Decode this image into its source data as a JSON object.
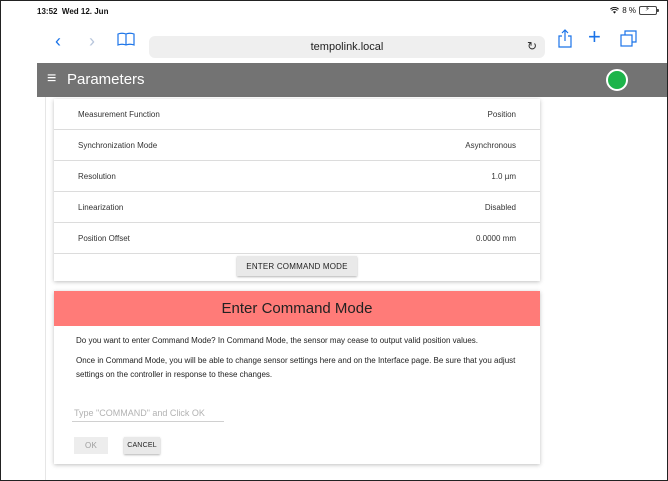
{
  "status_bar": {
    "time": "13:52",
    "date": "Wed 12. Jun",
    "battery": "8 %"
  },
  "browser": {
    "url": "tempolink.local",
    "icons": {
      "back": "chevron-left-icon",
      "forward": "chevron-right-icon",
      "bookmarks": "book-icon",
      "reload": "reload-icon",
      "share": "share-icon",
      "new_tab": "plus-icon",
      "tabs": "tabs-icon"
    }
  },
  "app_bar": {
    "menu_icon": "hamburger-icon",
    "title": "Parameters",
    "status_color": "#1db44a"
  },
  "parameters": [
    {
      "label": "Measurement Function",
      "value": "Position"
    },
    {
      "label": "Synchronization Mode",
      "value": "Asynchronous"
    },
    {
      "label": "Resolution",
      "value": "1.0 µm"
    },
    {
      "label": "Linearization",
      "value": "Disabled"
    },
    {
      "label": "Position Offset",
      "value": "0.0000 mm"
    }
  ],
  "enter_command_button": "ENTER COMMAND MODE",
  "dialog": {
    "title": "Enter Command Mode",
    "message1": "Do you want to enter Command Mode? In Command Mode, the sensor may cease to output valid position values.",
    "message2": "Once in Command Mode, you will be able to change sensor settings here and on the Interface page. Be sure that you adjust settings on the controller in response to these changes.",
    "input_placeholder": "Type \"COMMAND\" and Click OK",
    "ok_label": "OK",
    "cancel_label": "CANCEL",
    "header_color": "#ff7b78"
  }
}
